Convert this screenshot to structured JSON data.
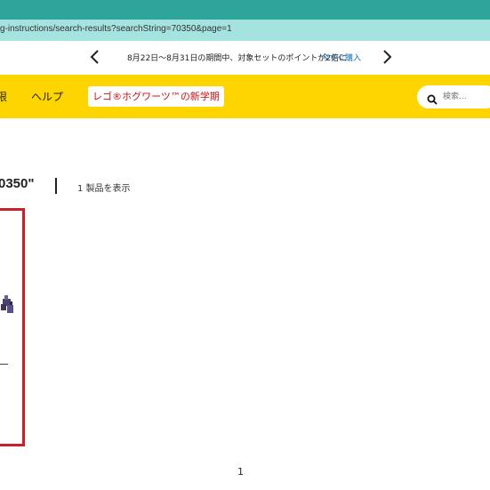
{
  "browser": {
    "url_fragment": "g-instructions/search-results?searchString=70350&page=1"
  },
  "promo": {
    "message": "8月22日～8月31日の期間中、対象セットのポイントが2倍に",
    "link_label": "今すぐ購入"
  },
  "nav": {
    "cut_item": "限",
    "help_label": "ヘルプ",
    "promo_button_label": "レゴ®ホグワーツ™の新学期",
    "search_placeholder": "検索..."
  },
  "results": {
    "query_label": "0350\"",
    "count_label": "1 製品を表示"
  },
  "pagination": {
    "current_page": "1"
  },
  "colors": {
    "chrome": "#2ea59a",
    "address_bar": "#a4e3e0",
    "nav_yellow": "#ffd500",
    "promo_red": "#d01012",
    "highlight_red": "#c8202a",
    "link_blue": "#1a6fb3"
  }
}
